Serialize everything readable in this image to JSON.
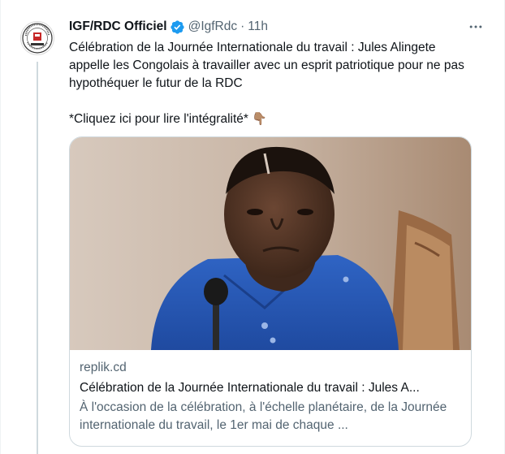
{
  "tweet": {
    "author_name": "IGF/RDC Officiel",
    "handle": "@IgfRdc",
    "separator": "·",
    "time": "11h",
    "text_main": "Célébration de la Journée Internationale du travail : Jules Alingete appelle les Congolais à travailler avec un esprit patriotique pour ne pas hypothéquer le futur de la RDC",
    "text_cta": "*Cliquez ici pour lire l'intégralité*",
    "cta_emoji": "👇🏽",
    "avatar_icon": "inspection-generale-des-finances-seal-icon",
    "verified_icon": "verified-badge-icon",
    "more_icon": "more-options-icon"
  },
  "card": {
    "domain": "replik.cd",
    "title": "Célébration de la Journée Internationale du travail : Jules A...",
    "description": "À l'occasion de la célébration, à l'échelle planétaire, de la Journée internationale du travail, le 1er mai de chaque ..."
  },
  "colors": {
    "verified": "#1d9bf0",
    "secondary_text": "#536471",
    "border": "#cfd9de",
    "thread_line": "#cfd9de"
  }
}
